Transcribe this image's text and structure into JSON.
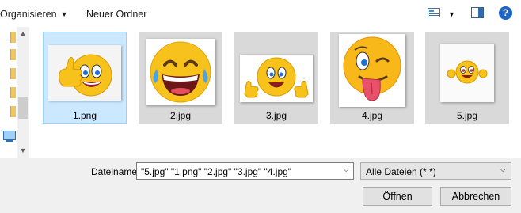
{
  "toolbar": {
    "organise_label": "Organisieren",
    "new_folder_label": "Neuer Ordner",
    "help_label": "?"
  },
  "files": [
    {
      "name": "1.png",
      "selected": false
    },
    {
      "name": "2.jpg",
      "selected": true
    },
    {
      "name": "3.jpg",
      "selected": true
    },
    {
      "name": "4.jpg",
      "selected": true
    },
    {
      "name": "5.jpg",
      "selected": true
    }
  ],
  "filename": {
    "label": "Dateiname:",
    "value": "\"5.jpg\" \"1.png\" \"2.jpg\" \"3.jpg\" \"4.jpg\""
  },
  "filetype": {
    "value": "Alle Dateien (*.*)"
  },
  "buttons": {
    "open": "Öffnen",
    "cancel": "Abbrechen"
  },
  "colors": {
    "selection_fill": "#cce8ff",
    "emoji_yellow": "#f7c21b",
    "help_blue": "#1c65c2"
  }
}
